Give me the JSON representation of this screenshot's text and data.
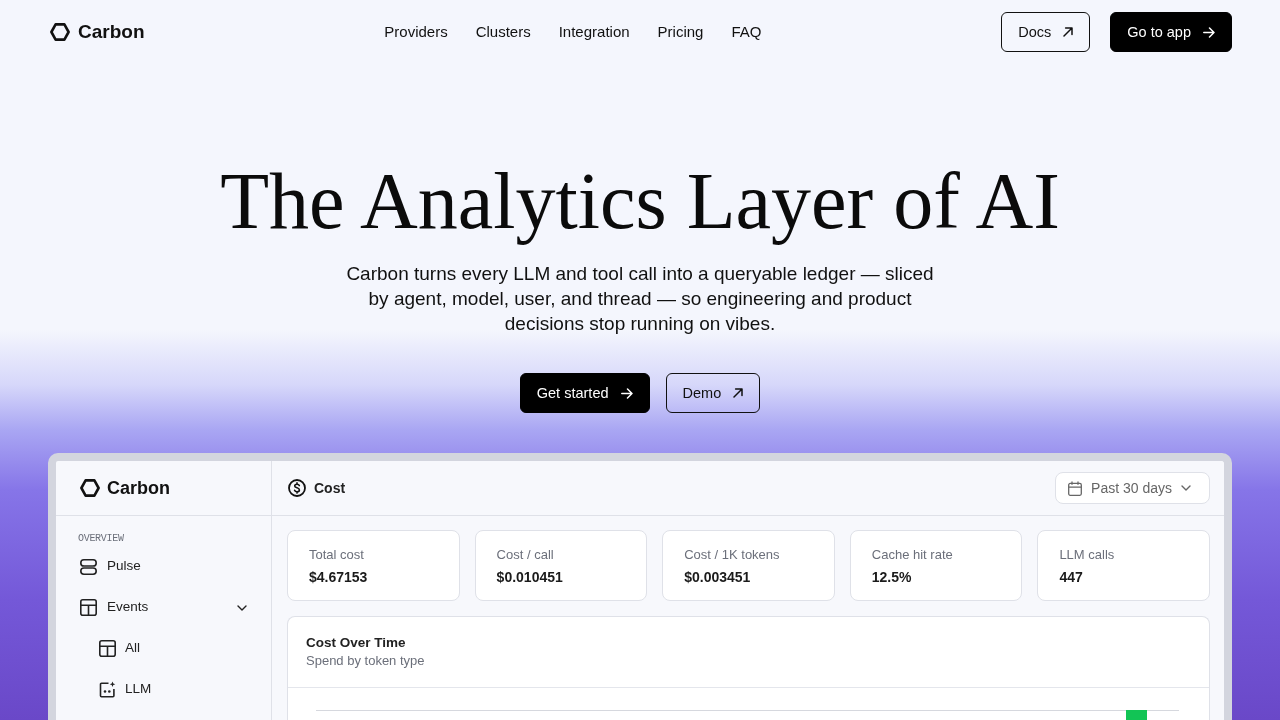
{
  "nav": {
    "brand": "Carbon",
    "links": [
      "Providers",
      "Clusters",
      "Integration",
      "Pricing",
      "FAQ"
    ],
    "buttons": [
      {
        "label": "Docs",
        "kind": "outline"
      },
      {
        "label": "Go to app",
        "kind": "solid"
      }
    ]
  },
  "hero": {
    "title": "The Analytics Layer of AI",
    "subtitle": "Carbon turns every LLM and tool call into a queryable ledger — sliced by agent, model, user, and thread — so engineering and product decisions stop running on vibes.",
    "buttons": [
      {
        "label": "Get started",
        "kind": "solid"
      },
      {
        "label": "Demo",
        "kind": "outline"
      }
    ]
  },
  "app_preview": {
    "sidebar": {
      "brand": "Carbon",
      "section": "OVERVIEW",
      "items": [
        {
          "label": "Pulse",
          "kind": "link"
        },
        {
          "label": "Events",
          "kind": "group",
          "expanded": true,
          "children": [
            {
              "label": "All"
            },
            {
              "label": "LLM"
            }
          ]
        }
      ]
    },
    "header": {
      "title": "Cost",
      "date_range": "Past 30 days"
    },
    "stats": [
      {
        "label": "Total cost",
        "value": "$4.67153"
      },
      {
        "label": "Cost / call",
        "value": "$0.010451"
      },
      {
        "label": "Cost / 1K tokens",
        "value": "$0.003451"
      },
      {
        "label": "Cache hit rate",
        "value": "12.5%"
      },
      {
        "label": "LLM calls",
        "value": "447"
      }
    ],
    "chart_card": {
      "title": "Cost Over Time",
      "subtitle": "Spend by token type"
    }
  }
}
